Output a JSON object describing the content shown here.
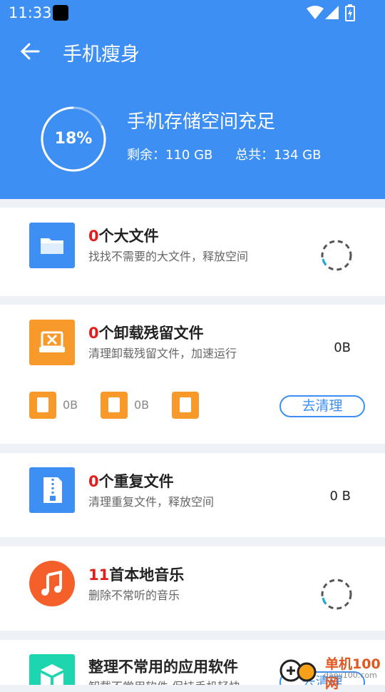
{
  "status_bar": {
    "time": "11:33"
  },
  "header": {
    "title": "手机瘦身",
    "percent": "18%",
    "usage_fraction": 0.18,
    "status": "手机存储空间充足",
    "remaining": "剩余：110 GB",
    "total": "总共：134 GB"
  },
  "cards": [
    {
      "count": "0",
      "title": "个大文件",
      "subtitle": "找找不需要的大文件，释放空间"
    },
    {
      "count": "0",
      "title": "个卸载残留文件",
      "subtitle": "清理卸载残留文件，加速运行",
      "size": "0B",
      "mini": [
        "0B",
        "0B"
      ],
      "button": "去清理"
    },
    {
      "count": "0",
      "title": "个重复文件",
      "subtitle": "清理重复文件，释放空间",
      "size": "0 B"
    },
    {
      "count": "11",
      "title": "首本地音乐",
      "subtitle": "删除不常听的音乐"
    },
    {
      "title": "整理不常用的应用软件",
      "subtitle": "卸载不常用软件,保持手机轻快",
      "button": "去清理"
    }
  ],
  "watermark": {
    "title": "单机100网",
    "url": "danji100.com"
  },
  "colors": {
    "primary": "#3d8ff3",
    "orange": "#f79a2b",
    "music": "#f5602a",
    "green": "#1dd6b0",
    "count_red": "#e31c1c"
  }
}
